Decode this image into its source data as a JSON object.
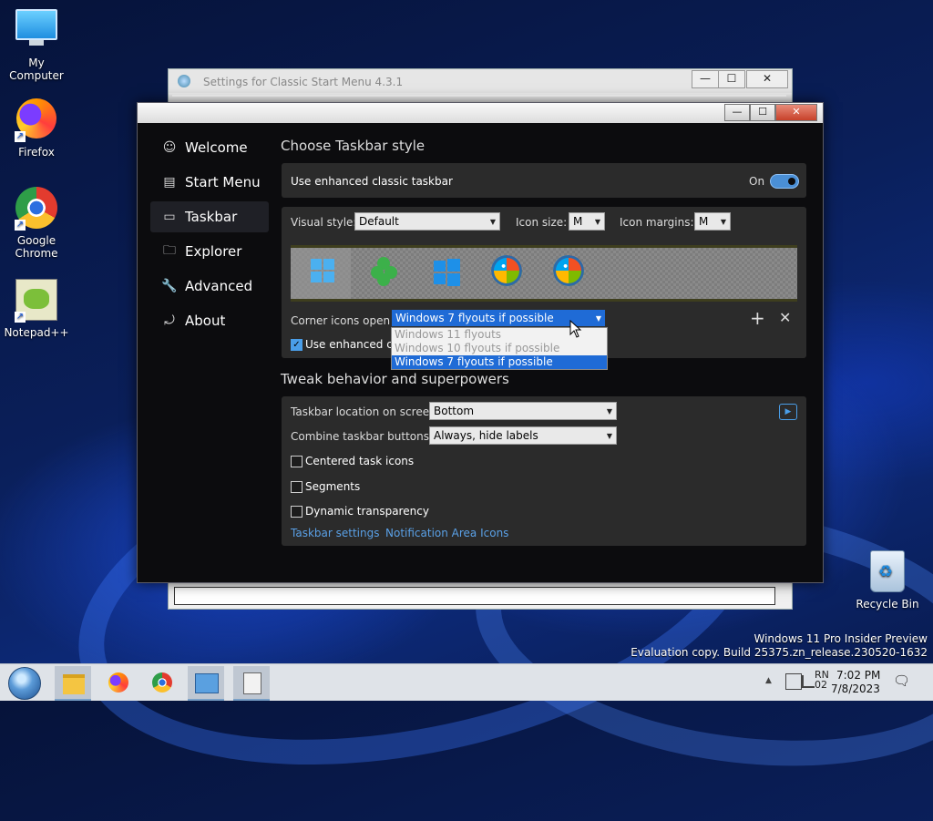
{
  "desktop": {
    "icons": [
      {
        "label": "My Computer"
      },
      {
        "label": "Firefox"
      },
      {
        "label": "Google Chrome"
      },
      {
        "label": "Notepad++"
      },
      {
        "label": "Recycle Bin"
      }
    ],
    "watermark": {
      "line1": "Windows 11 Pro Insider Preview",
      "line2": "Evaluation copy. Build 25375.zn_release.230520-1632"
    }
  },
  "back_window": {
    "title": "Settings for Classic Start Menu 4.3.1",
    "controls": {
      "minimize": "—",
      "maximize": "☐",
      "close": "✕"
    }
  },
  "window": {
    "controls": {
      "minimize": "—",
      "maximize": "☐",
      "close": "✕"
    },
    "sidebar": {
      "items": [
        {
          "label": "Welcome",
          "icon": "smile-icon",
          "glyph": "☺"
        },
        {
          "label": "Start Menu",
          "icon": "start-menu-icon",
          "glyph": "▤"
        },
        {
          "label": "Taskbar",
          "icon": "taskbar-icon",
          "glyph": "▭"
        },
        {
          "label": "Explorer",
          "icon": "folder-icon",
          "glyph": "🗀"
        },
        {
          "label": "Advanced",
          "icon": "wrench-icon",
          "glyph": "🔧"
        },
        {
          "label": "About",
          "icon": "about-icon",
          "glyph": "⤾"
        }
      ],
      "selected": "Taskbar"
    },
    "section1": {
      "heading": "Choose Taskbar style",
      "enhanced_label": "Use enhanced classic taskbar",
      "enhanced_state": "On",
      "visual_style_label": "Visual style:",
      "visual_style_value": "Default",
      "icon_size_label": "Icon size:",
      "icon_size_value": "M",
      "icon_margins_label": "Icon margins:",
      "icon_margins_value": "M",
      "preview_icons": [
        "windows11-logo-icon",
        "clover-icon",
        "windows10-logo-icon",
        "windows7-orb-icon",
        "windows7-orb-icon"
      ],
      "corner_label": "Corner icons open:",
      "corner_value": "Windows 7 flyouts if possible",
      "corner_options": [
        "Windows 11 flyouts",
        "Windows 10 flyouts if possible",
        "Windows 7 flyouts if possible"
      ],
      "corner_selected_index": 2,
      "enhanced_classic_label": "Use enhanced classic",
      "enhanced_classic_tail": "...",
      "add_glyph": "+",
      "remove_glyph": "✕"
    },
    "section2": {
      "heading": "Tweak behavior and superpowers",
      "location_label": "Taskbar location on screen:",
      "location_value": "Bottom",
      "combine_label": "Combine taskbar buttons:",
      "combine_value": "Always, hide labels",
      "centered_label": "Centered task icons",
      "segments_label": "Segments",
      "transparency_label": "Dynamic transparency",
      "link_taskbar_settings": "Taskbar settings",
      "link_notification_icons": "Notification Area Icons"
    }
  },
  "taskbar": {
    "apps": [
      "start-orb-icon",
      "file-explorer-icon",
      "firefox-icon",
      "chrome-icon",
      "control-panel-icon",
      "settings-app-icon"
    ],
    "tray": {
      "up_arrow": "▲",
      "lang": "RN 02",
      "time": "7:02 PM",
      "date": "7/8/2023",
      "notification": "🗨"
    }
  },
  "colors": {
    "accent": "#4a8fd6",
    "card": "#2b2b2b",
    "window_bg": "#0c0c0e",
    "link": "#5aa0e6"
  }
}
